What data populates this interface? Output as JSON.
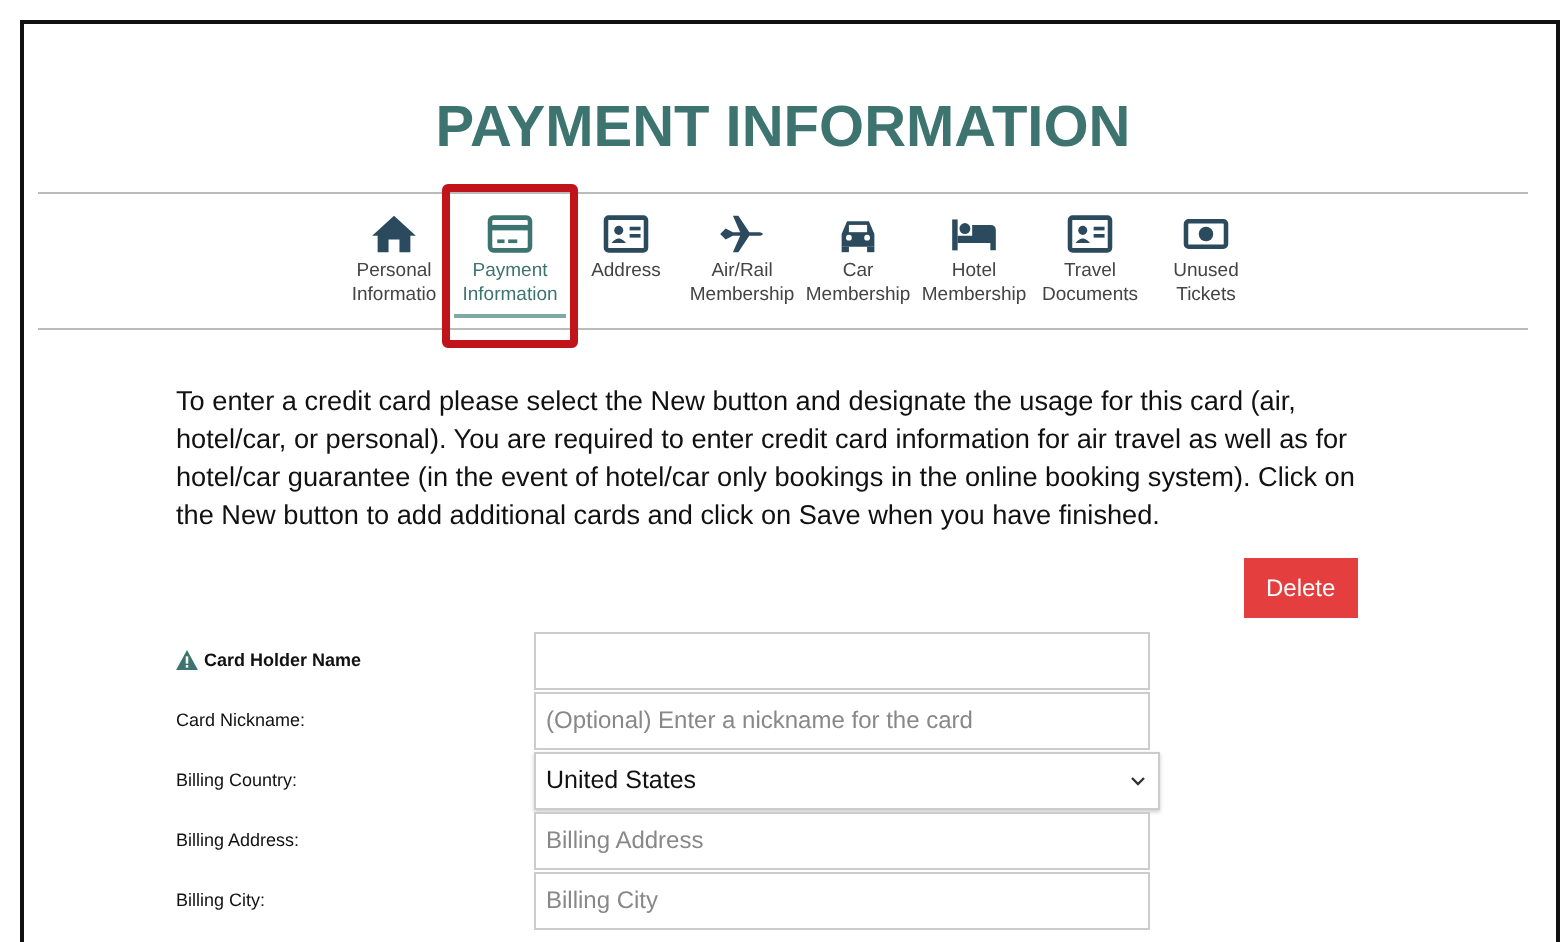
{
  "title": "PAYMENT INFORMATION",
  "tabs": [
    {
      "label": "Personal Informatio",
      "kind": "home",
      "selected": false,
      "highlighted": false
    },
    {
      "label": "Payment Information",
      "kind": "card",
      "selected": true,
      "highlighted": true
    },
    {
      "label": "Address",
      "kind": "id",
      "selected": false,
      "highlighted": false
    },
    {
      "label": "Air/Rail Membership",
      "kind": "plane",
      "selected": false,
      "highlighted": false
    },
    {
      "label": "Car Membership",
      "kind": "car",
      "selected": false,
      "highlighted": false
    },
    {
      "label": "Hotel Membership",
      "kind": "bed",
      "selected": false,
      "highlighted": false
    },
    {
      "label": "Travel Documents",
      "kind": "id",
      "selected": false,
      "highlighted": false
    },
    {
      "label": "Unused Tickets",
      "kind": "money",
      "selected": false,
      "highlighted": false
    }
  ],
  "intro": "To enter a credit card please select the New button and designate the usage for this card (air, hotel/car, or personal). You are required to enter credit card information for air travel as well as for hotel/car guarantee (in the event of hotel/car only bookings in the online booking system). Click on the New button to add additional cards and click on Save when you have finished.",
  "delete_button": "Delete",
  "fields": [
    {
      "label": "Card Holder Name",
      "kind": "text",
      "required": true
    },
    {
      "label": "Card Nickname:",
      "kind": "text",
      "required": false,
      "placeholder": "(Optional) Enter a nickname for the card"
    },
    {
      "label": "Billing Country:",
      "kind": "select",
      "required": false,
      "value": "United States"
    },
    {
      "label": "Billing Address:",
      "kind": "text",
      "required": false,
      "placeholder": "Billing Address"
    },
    {
      "label": "Billing City:",
      "kind": "text",
      "required": false,
      "placeholder": "Billing City"
    }
  ]
}
